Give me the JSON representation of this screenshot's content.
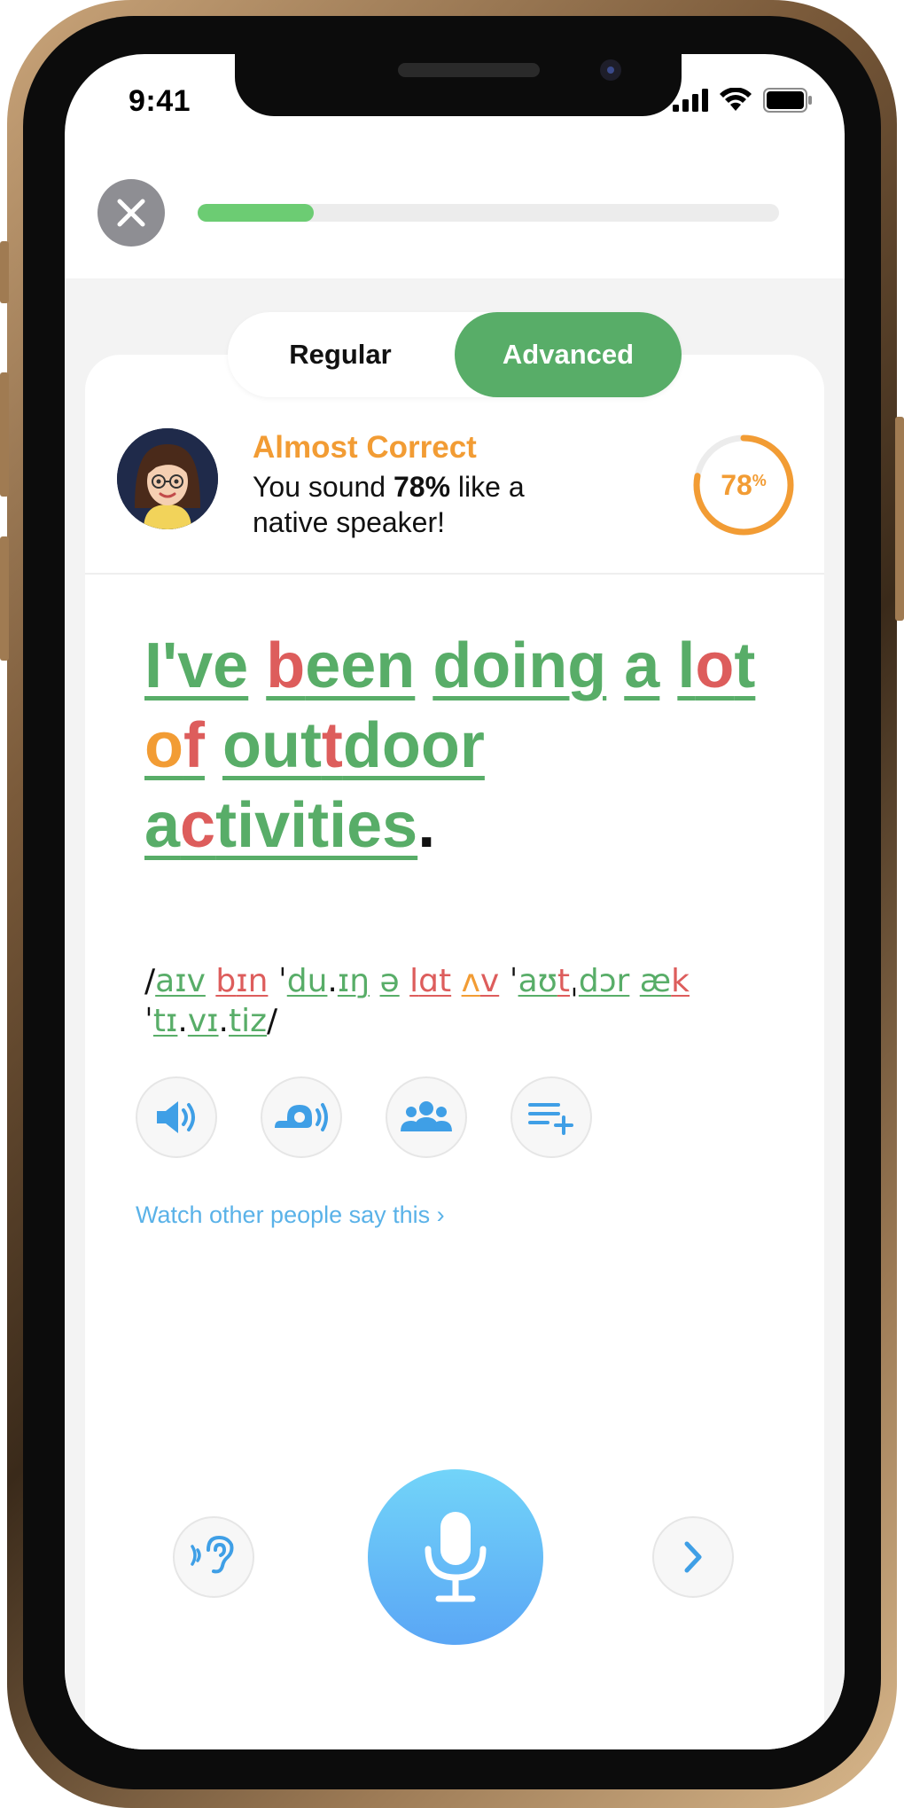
{
  "status_bar": {
    "time": "9:41"
  },
  "header": {
    "close_icon": "x-icon",
    "progress": 0.2
  },
  "mode_toggle": {
    "regular_label": "Regular",
    "advanced_label": "Advanced",
    "selected": "Advanced"
  },
  "result": {
    "title": "Almost Correct",
    "message_prefix": "You sound ",
    "percent_label": "78%",
    "message_suffix": " like a native speaker!",
    "score_number": "78",
    "score_unit": "%",
    "score_value": 78
  },
  "sentence": {
    "words": [
      [
        {
          "t": "I've",
          "c": "g"
        }
      ],
      [
        {
          "t": "b",
          "c": "r"
        },
        {
          "t": "een",
          "c": "g"
        }
      ],
      [
        {
          "t": "doing",
          "c": "g"
        }
      ],
      [
        {
          "t": "a",
          "c": "g"
        }
      ],
      [
        {
          "t": "l",
          "c": "g"
        },
        {
          "t": "o",
          "c": "r"
        },
        {
          "t": "t",
          "c": "g"
        }
      ],
      [
        {
          "t": "o",
          "c": "o"
        },
        {
          "t": "f",
          "c": "r"
        }
      ],
      [
        {
          "t": "out",
          "c": "g"
        },
        {
          "t": "t",
          "c": "r"
        },
        {
          "t": "door",
          "c": "g"
        }
      ],
      [
        {
          "t": "a",
          "c": "g"
        },
        {
          "t": "c",
          "c": "r"
        },
        {
          "t": "tivities",
          "c": "g"
        }
      ]
    ],
    "end_punct": "."
  },
  "ipa": {
    "segments": [
      {
        "t": "/",
        "c": "k"
      },
      {
        "t": "aɪv",
        "c": "g"
      },
      {
        "t": " ",
        "c": "k"
      },
      {
        "t": "b",
        "c": "r"
      },
      {
        "t": "ɪn",
        "c": "r"
      },
      {
        "t": " ˈ",
        "c": "k"
      },
      {
        "t": "du",
        "c": "g"
      },
      {
        "t": ".",
        "c": "k"
      },
      {
        "t": "ɪŋ",
        "c": "g"
      },
      {
        "t": " ",
        "c": "k"
      },
      {
        "t": "ə",
        "c": "g"
      },
      {
        "t": " ",
        "c": "k"
      },
      {
        "t": "l",
        "c": "r"
      },
      {
        "t": "ɑ",
        "c": "r"
      },
      {
        "t": "t",
        "c": "r"
      },
      {
        "t": " ",
        "c": "k"
      },
      {
        "t": "ʌ",
        "c": "o"
      },
      {
        "t": "v",
        "c": "r"
      },
      {
        "t": " ˈ",
        "c": "k"
      },
      {
        "t": "aʊ",
        "c": "g"
      },
      {
        "t": "t",
        "c": "r"
      },
      {
        "t": "ˌ",
        "c": "k"
      },
      {
        "t": "dɔr",
        "c": "g"
      },
      {
        "t": " ",
        "c": "k"
      },
      {
        "t": "æ",
        "c": "g"
      },
      {
        "t": "k",
        "c": "r"
      },
      {
        "t": " ˈ",
        "c": "k"
      },
      {
        "t": "tɪ",
        "c": "g"
      },
      {
        "t": ".",
        "c": "k"
      },
      {
        "t": "vɪ",
        "c": "g"
      },
      {
        "t": ".",
        "c": "k"
      },
      {
        "t": "tiz",
        "c": "g"
      },
      {
        "t": "/",
        "c": "k"
      }
    ]
  },
  "actions": {
    "speaker_icon": "speaker-icon",
    "slow_icon": "snail-speaker-icon",
    "people_icon": "group-icon",
    "add_list_icon": "playlist-add-icon"
  },
  "watch_link": "Watch other people say this ›",
  "bottom": {
    "listen_icon": "ear-icon",
    "mic_icon": "microphone-icon",
    "next_icon": "chevron-right-icon"
  },
  "colors": {
    "green": "#58ad68",
    "red": "#dd5d5c",
    "orange": "#f29c34",
    "blue": "#5ab2e8"
  }
}
